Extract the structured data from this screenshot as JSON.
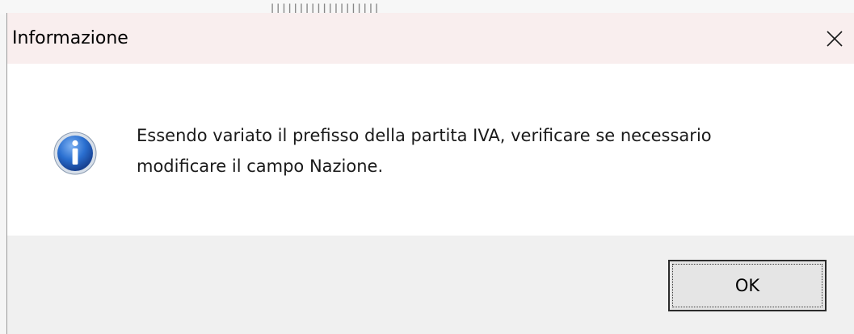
{
  "dialog": {
    "title": "Informazione",
    "icon": "info-icon",
    "message_line1": "Essendo variato il prefisso della partita IVA, verificare se necessario",
    "message_line2": "modificare il campo Nazione.",
    "ok_label": "OK",
    "close_glyph": "✕"
  },
  "colors": {
    "titlebar": "#f9eeee",
    "content": "#ffffff",
    "footer": "#f0f0f0",
    "button": "#e5e5e5",
    "icon_blue": "#1e5fc2"
  }
}
